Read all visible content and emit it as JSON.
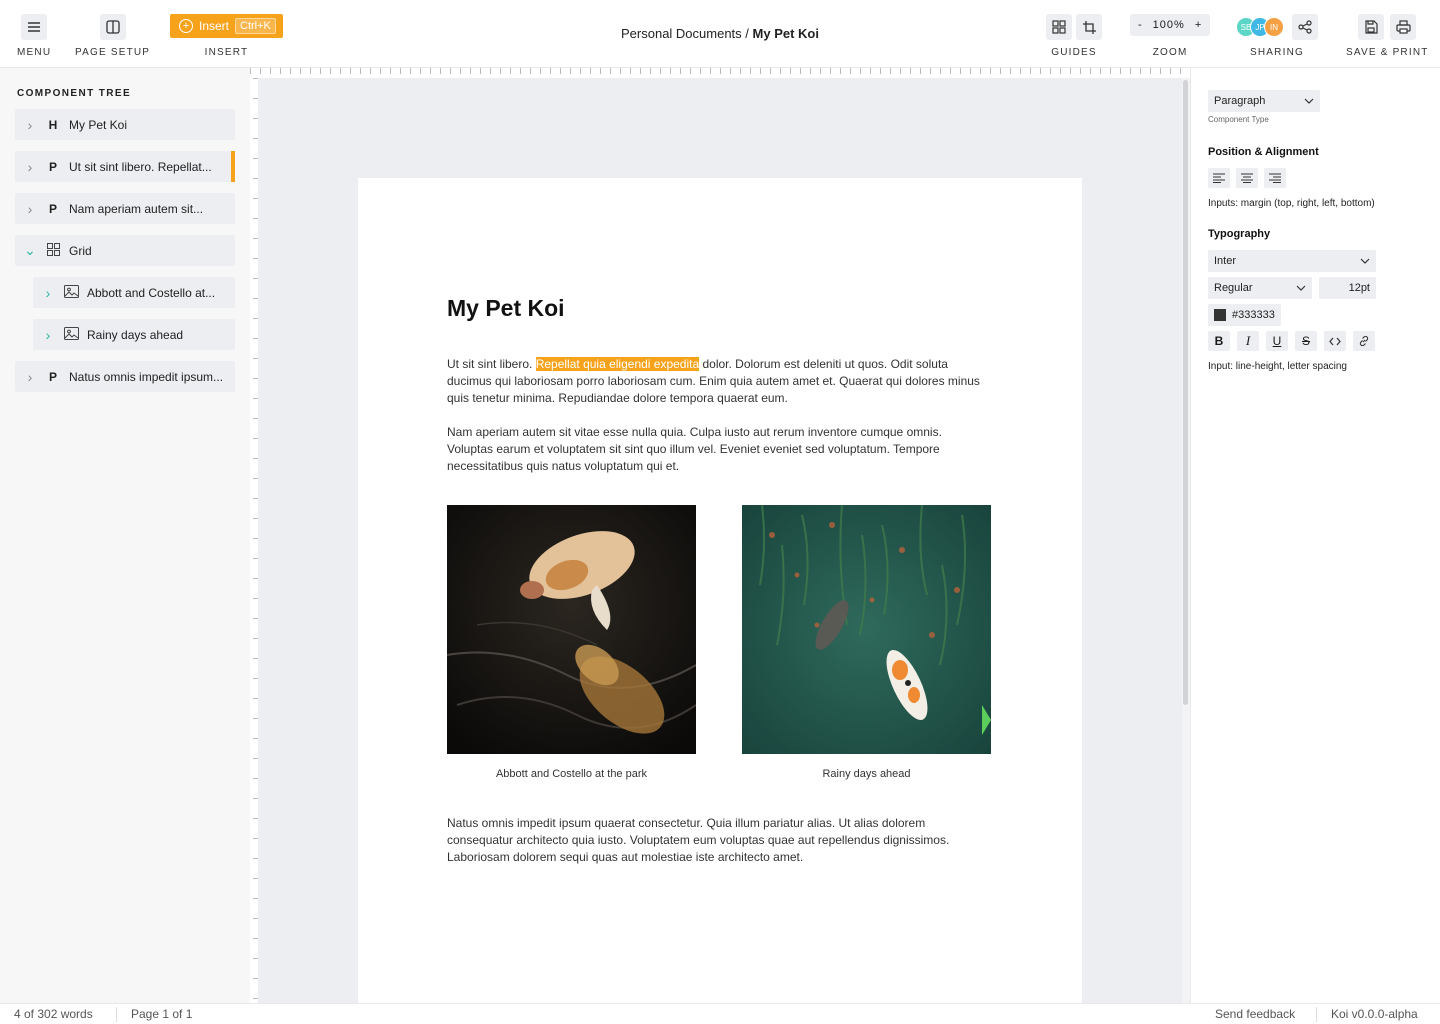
{
  "toolbar": {
    "menu_label": "MENU",
    "page_setup_label": "PAGE SETUP",
    "insert_button": "Insert",
    "insert_shortcut": "Ctrl+K",
    "insert_label": "INSERT",
    "guides_label": "GUIDES",
    "zoom": {
      "minus": "-",
      "value": "100%",
      "plus": "+",
      "label": "ZOOM"
    },
    "sharing": {
      "label": "SHARING",
      "avatars": [
        {
          "initials": "SB",
          "color": "#5bd6c6"
        },
        {
          "initials": "JP",
          "color": "#3fb8e6"
        },
        {
          "initials": "IN",
          "color": "#f5a043"
        }
      ]
    },
    "save_print_label": "SAVE & PRINT"
  },
  "breadcrumb": {
    "parent": "Personal Documents /",
    "current": "My Pet Koi"
  },
  "sidebar": {
    "title": "COMPONENT TREE",
    "items": [
      {
        "type": "H",
        "label": "My Pet Koi"
      },
      {
        "type": "P",
        "label": "Ut sit sint libero. Repellat..."
      },
      {
        "type": "P",
        "label": "Nam aperiam autem sit..."
      },
      {
        "type": "grid",
        "label": "Grid"
      },
      {
        "type": "img",
        "label": "Abbott and Costello at..."
      },
      {
        "type": "img",
        "label": "Rainy days ahead"
      },
      {
        "type": "P",
        "label": "Natus omnis impedit ipsum..."
      }
    ]
  },
  "document": {
    "title": "My Pet Koi",
    "para1_before": "Ut sit sint libero. ",
    "para1_highlight": "Repellat quia eligendi expedita",
    "para1_after": " dolor. Dolorum est deleniti ut quos. Odit soluta ducimus qui laboriosam porro laboriosam cum. Enim quia autem amet et. Quaerat qui dolores minus quis tenetur minima. Repudiandae dolore tempora quaerat eum.",
    "para2": "Nam aperiam autem sit vitae esse nulla quia. Culpa iusto aut rerum inventore cumque omnis. Voluptas earum et voluptatem sit sint quo illum vel. Eveniet eveniet sed voluptatum. Tempore necessitatibus quis natus voluptatum qui et.",
    "caption1": "Abbott and Costello at the park",
    "caption2": "Rainy days ahead",
    "para3": "Natus omnis impedit ipsum quaerat consectetur. Quia illum pariatur alias. Ut alias dolorem consequatur architecto quia iusto. Voluptatem eum voluptas quae aut repellendus dignissimos. Laboriosam dolorem sequi quas aut molestiae iste architecto amet."
  },
  "properties": {
    "component_type_value": "Paragraph",
    "component_type_label": "Component Type",
    "position_title": "Position & Alignment",
    "position_helper": "Inputs: margin (top, right, left, bottom)",
    "typography_title": "Typography",
    "font_family": "Inter",
    "font_weight": "Regular",
    "font_size": "12pt",
    "color_hex": "#333333",
    "typography_helper": "Input: line-height, letter spacing"
  },
  "status": {
    "word_count": "4 of 302 words",
    "page": "Page 1 of 1",
    "feedback": "Send feedback",
    "version": "Koi v0.0.0-alpha"
  }
}
